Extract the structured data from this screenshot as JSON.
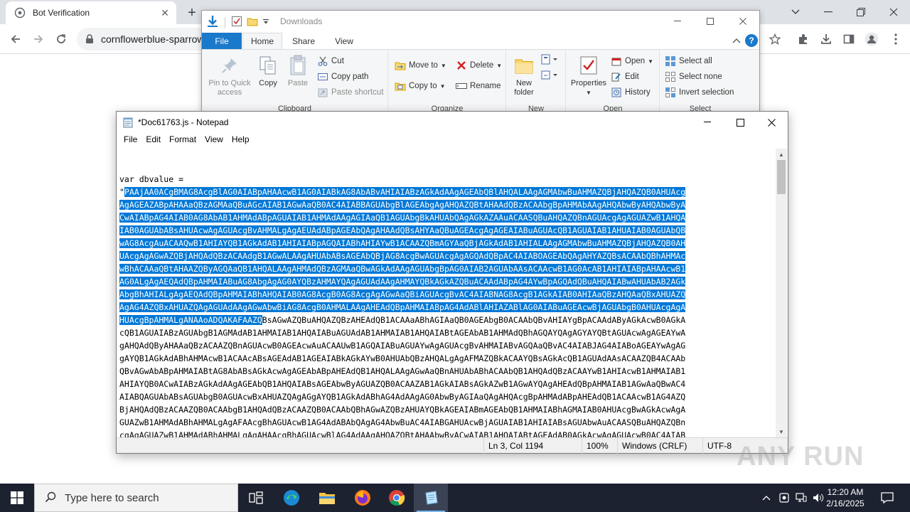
{
  "browser": {
    "tab_title": "Bot Verification",
    "url": "cornflowerblue-sparrow",
    "new_tab_label": "+"
  },
  "explorer": {
    "title": "Downloads",
    "tabs": [
      "File",
      "Home",
      "Share",
      "View"
    ],
    "clipboard": {
      "pin_label": "Pin to Quick access",
      "copy_label": "Copy",
      "paste_label": "Paste",
      "cut_label": "Cut",
      "copy_path_label": "Copy path",
      "paste_shortcut_label": "Paste shortcut",
      "group_label": "Clipboard"
    },
    "organize": {
      "move_to_label": "Move to",
      "copy_to_label": "Copy to",
      "delete_label": "Delete",
      "rename_label": "Rename",
      "group_label": "Organize"
    },
    "new": {
      "new_folder_label": "New folder",
      "group_label": "New"
    },
    "open": {
      "properties_label": "Properties",
      "open_label": "Open",
      "edit_label": "Edit",
      "history_label": "History",
      "group_label": "Open"
    },
    "select": {
      "select_all_label": "Select all",
      "select_none_label": "Select none",
      "invert_label": "Invert selection",
      "group_label": "Select"
    },
    "help_label": "?"
  },
  "notepad": {
    "title": "*Doc61763.js - Notepad",
    "menu": [
      "File",
      "Edit",
      "Format",
      "View",
      "Help"
    ],
    "code": {
      "line1": "var dbvalue =",
      "quote": "\"",
      "sel_lines": [
        "PAAjAA0ACgBMAG8AcgBlAG0AIABpAHAAcwB1AG0AIABkAG8AbABvAHIAIABzAGkAdAAgAGEAbQBlAHQALAAgAGMAbwBuAHMAZQBjAHQAZQB0AHUAcg",
        "AgAGEAZABpAHAAaQBzAGMAaQBuAGcAIAB1AGwAaQB0AC4AIABBAGUAbgBlAGEAbgAgAHQAZQBtAHAAdQBzACAAbgBpAHMAbAAgAHQAbwByAHQAbwByA",
        "CwAIABpAG4AIAB0AG8AbAB1AHMAdABpAGUAIAB1AHMAdAAgAGIAaQB1AGUAbgBkAHUAbQAgAGkAZAAuACAASQBuAHQAZQBnAGUAcgAgAGUAZwB1AHQA",
        "IAB0AGUAbABsAHUAcwAgAGUAcgBvAHMALgAgAEUAdABpAGEAbQAgAHAAdQBsAHYAaQBuAGEAcgAgAGEAIABuAGUAcQB1AGUAIAB1AHUAIAB0AGUAbQB",
        "wAG8AcgAuACAAQwB1AHIAYQB1AGkAdAB1AHIAIABpAGQAIABhAHIAYwB1ACAAZQBmAGYAaQBjAGkAdAB1AHIALAAgAGMAbwBuAHMAZQBjAHQAZQB0AH",
        "UAcgAgAGwAZQBjAHQAdQBzACAAdgB1AGwALAAgAHUAbABsAGEAbQBjAG8AcgBwAGUAcgAgAGQAdQBpAC4AIABOAGEAbQAgAHYAZQBsACAAbQBhAHMAc",
        "wBhACAAaQBtAHAAZQByAGQAaQB1AHQALAAgAHMAdQBzAGMAaQBwAGkAdAAgAGUAbgBpAG0AIAB2AGUAbAAsACAAcwB1AG0AcAB1AHIAIABpAHAAcwB1",
        "AG0ALgAgAEQAdQBpAHMAIABuAG8AbgAgAG0AYQBzAHMAYQAgAGUAdAAgAHMAYQBkAGkAZQBuACAAdABpAG4AYwBpAGQAdQBuAHQAIABwAHUAbAB2AGk",
        "AbgBhAHIALgAgAEQAdQBpAHMAIABhAHQAIAB0AG8AcgB0AG8AcgAgAGwAaQBiAGUAcgBvAC4AIABNAG8AcgB1AGkAIAB0AHIAaQBzAHQAaQBxAHUAZQ",
        "AgAG4AZQBxAHUAZQAgAGUAdAAgAGwAbwBiAG8AcgB0AHMALAAgAHEAdQBpAHMAIABpAG4AdABlAHIAZABlAG0AIABuAGEAcwBjAGUAbgB0AHUAcgAgA",
        "HUAcgBpAHMALgANAAoADQAKAFAAZQ"
      ],
      "line13_rest": "BsAGwAZQBuAHQAZQBzAHEAdQB1ACAAaABhAGIAaQB0AGEAbgB0ACAAbQBvAHIAYgBpACAAdAByAGkAcwB0AGkA",
      "lines": [
        "cQB1AGUAIABzAGUAbgB1AGMAdAB1AHMAIAB1AHQAIABuAGUAdAB1AHMAIAB1AHQAIABtAGEAbAB1AHMAdQBhAGQAYQAgAGYAYQBtAGUAcwAgAGEAYwA",
        "gAHQAdQByAHAAaQBzACAAZQBnAGUAcwB0AGEAcwAuACAAUwB1AGQAIABuAGUAYwAgAGUAcgBvAHMAIABvAGQAaQBvAC4AIABJAG4AIABoAGEAYwAgAG",
        "gAYQB1AGkAdABhAHMAcwB1ACAAcABsAGEAdAB1AGEAIABkAGkAYwB0AHUAbQBzAHQALgAgAFMAZQBkACAAYQBsAGkAcQB1AGUAdAAsACAAZQB4ACAAb",
        "QBvAGwAbABpAHMAIABtAG8AbABsAGkAcwAgAGEAbABpAHEAdQB1AHQALAAgAGwAaQBnAHUAbABhACAAbQB1AHQAdQBzACAAYwB1AHIAcwB1AHMAIAB1",
        "AHIAYQB0ACwAIABzAGkAdAAgAGEAbQB1AHQAIABsAGEAbwByAGUAZQB0ACAAZAB1AGkAIABsAGkAZwB1AGwAYQAgAHEAdQBpAHMAIAB1AGwAaQBwAC4",
        "AIABQAGUAbABsAGUAbgB0AGUAcwBxAHUAZQAgAGgAYQB1AGkAdABhAG4AdAAgAG0AbwByAGIAaQAgAHQAcgBpAHMAdABpAHEAdQB1ACAAcwB1AG4AZQ",
        "BjAHQAdQBzACAAZQB0ACAAbgB1AHQAdQBzACAAZQB0ACAAbQBhAGwAZQBzAHUAYQBkAGEAIABmAGEAbQB1AHMAIABhAGMAIAB0AHUAcgBwAGkAcwAgA",
        "GUAZwB1AHMAdABhAHMALgAgAFAAcgBhAGUAcwB1AG4AdABAbQAgAG4AbwBuAC4AIABGAHUAcwBjAGUAIAB1AHIAIABsAGUAbwAuACAASQBuAHQAZQBn",
        "cgAgAGUAZwB1AHMAdABhAHMALgAgAHAAcgBhAGUAcwBlAG4AdAAgAHQAZQBtAHAAbwByACwAIAB1AHQAIABtAGEAdAB0AGkAcwAgAGUAcwB0AC4AIAB"
      ]
    },
    "status": {
      "position": "Ln 3, Col 1194",
      "zoom": "100%",
      "line_ending": "Windows (CRLF)",
      "encoding": "UTF-8"
    }
  },
  "watermark": "ANY RUN",
  "taskbar": {
    "search_placeholder": "Type here to search",
    "time": "12:20 AM",
    "date": "2/16/2025"
  },
  "colors": {
    "selection": "#0078d7",
    "taskbar": "#1c2230",
    "explorer_file_tab": "#1979ca"
  }
}
